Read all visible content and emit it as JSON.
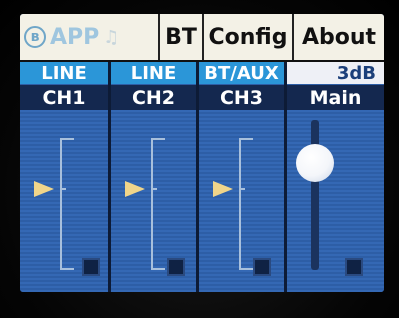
{
  "tabs": {
    "app": {
      "label": "APP",
      "icon": "bluetooth-icon",
      "second_icon": "music-note-icon"
    },
    "bt": {
      "label": "BT"
    },
    "config": {
      "label": "Config"
    },
    "about": {
      "label": "About"
    }
  },
  "channels": [
    {
      "input": "LINE",
      "name": "CH1",
      "level_marker": "▶"
    },
    {
      "input": "LINE",
      "name": "CH2",
      "level_marker": "▶"
    },
    {
      "input": "BT/AUX",
      "name": "CH3",
      "level_marker": "▶"
    }
  ],
  "main": {
    "gain": "3dB",
    "name": "Main"
  },
  "colors": {
    "screen_blue": "#2f5fa8",
    "header_cyan": "#2b96d8",
    "header_navy": "#14284f",
    "tab_bg": "#f3f1e6",
    "marker_yellow": "#f0d58a"
  }
}
